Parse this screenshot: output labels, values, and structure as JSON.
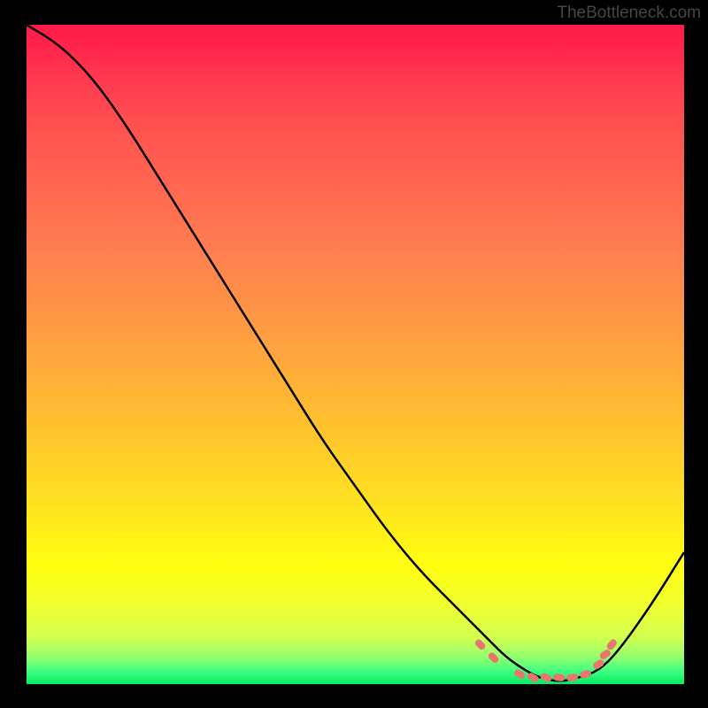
{
  "watermark": "TheBottleneck.com",
  "chart_data": {
    "type": "line",
    "title": "",
    "xlabel": "",
    "ylabel": "",
    "xlim": [
      0,
      100
    ],
    "ylim": [
      0,
      100
    ],
    "curve": {
      "description": "V-shaped bottleneck curve descending from top-left, reaching minimum around x=80, then rising",
      "x": [
        0,
        5,
        10,
        15,
        20,
        25,
        30,
        35,
        40,
        45,
        50,
        55,
        60,
        65,
        70,
        73,
        76,
        78,
        80,
        82,
        84,
        87,
        90,
        95,
        100
      ],
      "y": [
        100,
        97,
        92,
        85,
        77,
        69,
        61,
        53,
        45,
        37,
        30,
        23,
        17,
        12,
        7,
        4,
        2,
        1,
        0.5,
        0.5,
        1,
        2,
        5,
        12,
        20
      ]
    },
    "markers": {
      "description": "Salmon colored dash markers near curve minimum",
      "points": [
        {
          "x": 69,
          "y": 6
        },
        {
          "x": 71,
          "y": 4
        },
        {
          "x": 75,
          "y": 1.5
        },
        {
          "x": 77,
          "y": 1
        },
        {
          "x": 79,
          "y": 1
        },
        {
          "x": 81,
          "y": 1
        },
        {
          "x": 83,
          "y": 1
        },
        {
          "x": 85,
          "y": 1.5
        },
        {
          "x": 87,
          "y": 3
        },
        {
          "x": 88,
          "y": 4.5
        },
        {
          "x": 89,
          "y": 6
        }
      ],
      "color": "#e8766e"
    },
    "gradient_colors": {
      "top": "#ff1a4a",
      "middle": "#ffe020",
      "bottom": "#00f060"
    }
  }
}
